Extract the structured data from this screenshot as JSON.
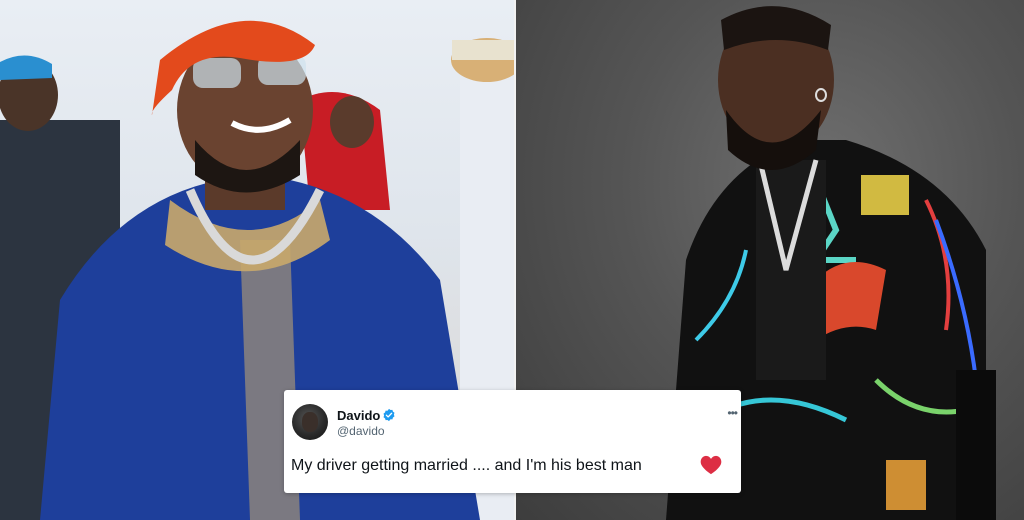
{
  "tweet": {
    "display_name": "Davido",
    "handle": "@davido",
    "text": "My driver getting married .... and I'm his best man",
    "icons": {
      "avatar": "profile-avatar",
      "verified": "verified-badge-icon",
      "heart": "red-heart-emoji",
      "more": "more-options-icon"
    },
    "colors": {
      "verified_badge": "#1d9bf0",
      "heart": "#dd2e44",
      "text": "#0f1419",
      "handle": "#536471"
    }
  },
  "photos": {
    "left": {
      "subject": "man in blue agbada and orange headwrap, smiling"
    },
    "right": {
      "subject": "man in colorful embroidered jacket, looking up"
    }
  }
}
